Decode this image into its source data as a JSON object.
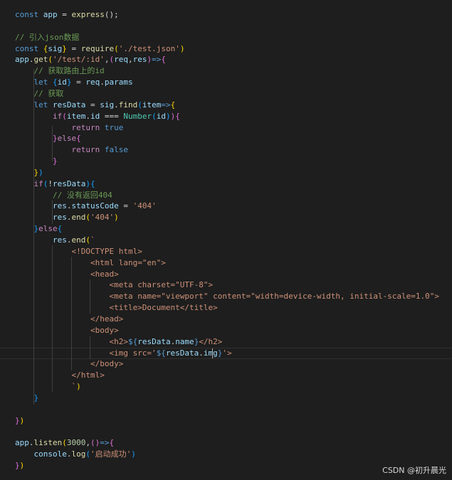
{
  "editor": {
    "language": "javascript",
    "lines": [
      [
        [
          "const",
          "kw"
        ],
        [
          " ",
          "txt"
        ],
        [
          "app",
          "var"
        ],
        [
          " = ",
          "txt"
        ],
        [
          "express",
          "fn"
        ],
        [
          "();",
          "txt"
        ]
      ],
      [],
      [
        [
          "// 引入json数据",
          "com"
        ]
      ],
      [
        [
          "const",
          "kw"
        ],
        [
          " ",
          "txt"
        ],
        [
          "{",
          "p1"
        ],
        [
          "sig",
          "var"
        ],
        [
          "}",
          "p1"
        ],
        [
          " = ",
          "txt"
        ],
        [
          "require",
          "fn"
        ],
        [
          "(",
          "p1"
        ],
        [
          "'./test.json'",
          "str"
        ],
        [
          ")",
          "p1"
        ]
      ],
      [
        [
          "app",
          "var"
        ],
        [
          ".",
          "txt"
        ],
        [
          "get",
          "fn"
        ],
        [
          "(",
          "p1"
        ],
        [
          "'/test/:id'",
          "str"
        ],
        [
          ",",
          "txt"
        ],
        [
          "(",
          "p2"
        ],
        [
          "req",
          "var"
        ],
        [
          ",",
          "txt"
        ],
        [
          "res",
          "var"
        ],
        [
          ")",
          "p2"
        ],
        [
          "=>",
          "kw"
        ],
        [
          "{",
          "p2"
        ]
      ],
      [
        [
          "    ",
          "txt"
        ],
        [
          "// 获取路由上的id",
          "com"
        ]
      ],
      [
        [
          "    ",
          "txt"
        ],
        [
          "let",
          "kw"
        ],
        [
          " ",
          "txt"
        ],
        [
          "{",
          "p3"
        ],
        [
          "id",
          "var"
        ],
        [
          "}",
          "p3"
        ],
        [
          " = ",
          "txt"
        ],
        [
          "req",
          "var"
        ],
        [
          ".",
          "txt"
        ],
        [
          "params",
          "var"
        ]
      ],
      [
        [
          "    ",
          "txt"
        ],
        [
          "// 获取",
          "com"
        ]
      ],
      [
        [
          "    ",
          "txt"
        ],
        [
          "let",
          "kw"
        ],
        [
          " ",
          "txt"
        ],
        [
          "resData",
          "var"
        ],
        [
          " = ",
          "txt"
        ],
        [
          "sig",
          "var"
        ],
        [
          ".",
          "txt"
        ],
        [
          "find",
          "fn"
        ],
        [
          "(",
          "p3"
        ],
        [
          "item",
          "var"
        ],
        [
          "=>",
          "kw"
        ],
        [
          "{",
          "p1"
        ]
      ],
      [
        [
          "        ",
          "txt"
        ],
        [
          "if",
          "ctl"
        ],
        [
          "(",
          "p2"
        ],
        [
          "item",
          "var"
        ],
        [
          ".",
          "txt"
        ],
        [
          "id",
          "var"
        ],
        [
          " === ",
          "txt"
        ],
        [
          "Number",
          "type"
        ],
        [
          "(",
          "p3"
        ],
        [
          "id",
          "var"
        ],
        [
          ")",
          "p3"
        ],
        [
          ")",
          "p2"
        ],
        [
          "{",
          "p2"
        ]
      ],
      [
        [
          "            ",
          "txt"
        ],
        [
          "return",
          "ctl"
        ],
        [
          " ",
          "txt"
        ],
        [
          "true",
          "kw"
        ]
      ],
      [
        [
          "        ",
          "txt"
        ],
        [
          "}",
          "p2"
        ],
        [
          "else",
          "ctl"
        ],
        [
          "{",
          "p2"
        ]
      ],
      [
        [
          "            ",
          "txt"
        ],
        [
          "return",
          "ctl"
        ],
        [
          " ",
          "txt"
        ],
        [
          "false",
          "kw"
        ]
      ],
      [
        [
          "        ",
          "txt"
        ],
        [
          "}",
          "p2"
        ]
      ],
      [
        [
          "    ",
          "txt"
        ],
        [
          "}",
          "p1"
        ],
        [
          ")",
          "p3"
        ]
      ],
      [
        [
          "    ",
          "txt"
        ],
        [
          "if",
          "ctl"
        ],
        [
          "(",
          "p3"
        ],
        [
          "!",
          "txt"
        ],
        [
          "resData",
          "var"
        ],
        [
          ")",
          "p3"
        ],
        [
          "{",
          "p3"
        ]
      ],
      [
        [
          "        ",
          "txt"
        ],
        [
          "// 没有返回404",
          "com"
        ]
      ],
      [
        [
          "        ",
          "txt"
        ],
        [
          "res",
          "var"
        ],
        [
          ".",
          "txt"
        ],
        [
          "statusCode",
          "var"
        ],
        [
          " = ",
          "txt"
        ],
        [
          "'404'",
          "str"
        ]
      ],
      [
        [
          "        ",
          "txt"
        ],
        [
          "res",
          "var"
        ],
        [
          ".",
          "txt"
        ],
        [
          "end",
          "fn"
        ],
        [
          "(",
          "p1"
        ],
        [
          "'404'",
          "str"
        ],
        [
          ")",
          "p1"
        ]
      ],
      [
        [
          "    ",
          "txt"
        ],
        [
          "}",
          "p3"
        ],
        [
          "else",
          "ctl"
        ],
        [
          "{",
          "p3"
        ]
      ],
      [
        [
          "        ",
          "txt"
        ],
        [
          "res",
          "var"
        ],
        [
          ".",
          "txt"
        ],
        [
          "end",
          "fn"
        ],
        [
          "(",
          "p1"
        ],
        [
          "`",
          "str"
        ]
      ],
      [
        [
          "            ",
          "txt"
        ],
        [
          "<!DOCTYPE html>",
          "str"
        ]
      ],
      [
        [
          "                ",
          "txt"
        ],
        [
          "<html lang=\"en\">",
          "str"
        ]
      ],
      [
        [
          "                ",
          "txt"
        ],
        [
          "<head>",
          "str"
        ]
      ],
      [
        [
          "                    ",
          "txt"
        ],
        [
          "<meta charset=\"UTF-8\">",
          "str"
        ]
      ],
      [
        [
          "                    ",
          "txt"
        ],
        [
          "<meta name=\"viewport\" content=\"width=device-width, initial-scale=1.0\">",
          "str"
        ]
      ],
      [
        [
          "                    ",
          "txt"
        ],
        [
          "<title>Document</title>",
          "str"
        ]
      ],
      [
        [
          "                ",
          "txt"
        ],
        [
          "</head>",
          "str"
        ]
      ],
      [
        [
          "                ",
          "txt"
        ],
        [
          "<body>",
          "str"
        ]
      ],
      [
        [
          "                    ",
          "txt"
        ],
        [
          "<h2>",
          "str"
        ],
        [
          "${",
          "kw"
        ],
        [
          "resData",
          "var"
        ],
        [
          ".",
          "txt"
        ],
        [
          "name",
          "var"
        ],
        [
          "}",
          "kw"
        ],
        [
          "</h2>",
          "str"
        ]
      ],
      [
        [
          "                    ",
          "txt"
        ],
        [
          "<img src='",
          "str"
        ],
        [
          "${",
          "kw"
        ],
        [
          "resData",
          "var"
        ],
        [
          ".",
          "txt"
        ],
        [
          "img",
          "var"
        ],
        [
          "}",
          "kw"
        ],
        [
          "'>",
          "str"
        ]
      ],
      [
        [
          "                ",
          "txt"
        ],
        [
          "</body>",
          "str"
        ]
      ],
      [
        [
          "            ",
          "txt"
        ],
        [
          "</html>",
          "str"
        ]
      ],
      [
        [
          "            ",
          "txt"
        ],
        [
          "`",
          "str"
        ],
        [
          ")",
          "p1"
        ]
      ],
      [
        [
          "    ",
          "txt"
        ],
        [
          "}",
          "p3"
        ]
      ],
      [],
      [
        [
          "}",
          "p2"
        ],
        [
          ")",
          "p1"
        ]
      ],
      [],
      [
        [
          "app",
          "var"
        ],
        [
          ".",
          "txt"
        ],
        [
          "listen",
          "fn"
        ],
        [
          "(",
          "p1"
        ],
        [
          "3000",
          "num"
        ],
        [
          ",",
          "txt"
        ],
        [
          "(",
          "p2"
        ],
        [
          ")",
          "p2"
        ],
        [
          "=>",
          "kw"
        ],
        [
          "{",
          "p2"
        ]
      ],
      [
        [
          "    ",
          "txt"
        ],
        [
          "console",
          "var"
        ],
        [
          ".",
          "txt"
        ],
        [
          "log",
          "fn"
        ],
        [
          "(",
          "p3"
        ],
        [
          "'启动成功'",
          "str"
        ],
        [
          ")",
          "p3"
        ]
      ],
      [
        [
          "}",
          "p2"
        ],
        [
          ")",
          "p1"
        ]
      ]
    ]
  },
  "watermark": "CSDN @初升晨光"
}
